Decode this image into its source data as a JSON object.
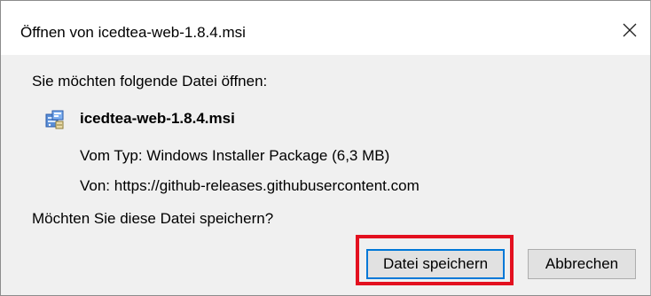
{
  "window": {
    "title": "Öffnen von icedtea-web-1.8.4.msi",
    "close_icon": "close-icon"
  },
  "dialog": {
    "prompt": "Sie möchten folgende Datei öffnen:",
    "file": {
      "icon": "msi-installer-icon",
      "name": "icedtea-web-1.8.4.msi",
      "type_line": "Vom Typ:  Windows Installer Package (6,3 MB)",
      "from_line": "Von:  https://github-releases.githubusercontent.com"
    },
    "question": "Möchten Sie diese Datei speichern?",
    "buttons": {
      "save_label": "Datei speichern",
      "cancel_label": "Abbrechen"
    },
    "highlight_color": "#e3101f",
    "focus_color": "#0078d7"
  }
}
